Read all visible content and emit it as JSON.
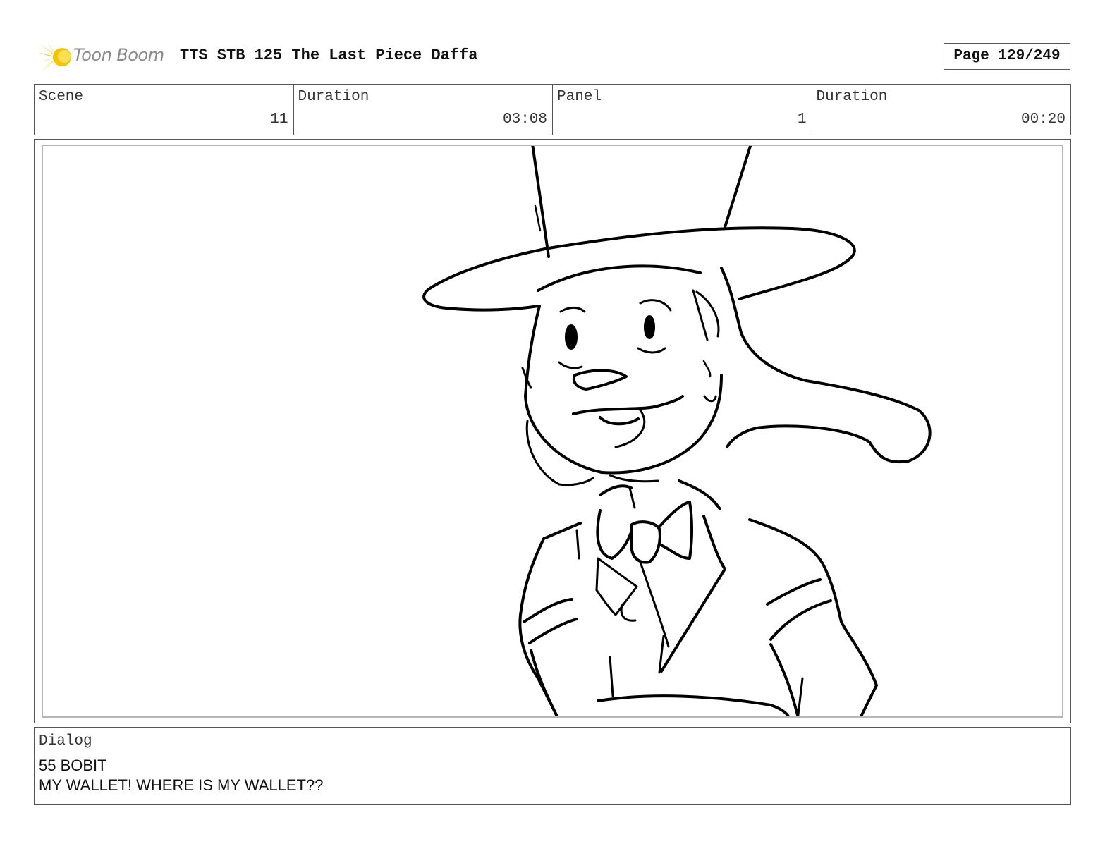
{
  "header": {
    "logo_text": "Toon Boom",
    "title": "TTS STB 125 The Last Piece Daffa",
    "page": "Page 129/249"
  },
  "info": {
    "scene_label": "Scene",
    "scene_value": "11",
    "scene_duration_label": "Duration",
    "scene_duration_value": "03:08",
    "panel_label": "Panel",
    "panel_value": "1",
    "panel_duration_label": "Duration",
    "panel_duration_value": "00:20"
  },
  "panel": {
    "drawing": "character-sketch"
  },
  "dialog": {
    "label": "Dialog",
    "speaker": "55 BOBIT",
    "line": "MY WALLET! WHERE IS MY WALLET??"
  },
  "colors": {
    "logo_accent": "#f5c400",
    "border": "#555555",
    "panel_inner_border": "#b5b5b5"
  }
}
